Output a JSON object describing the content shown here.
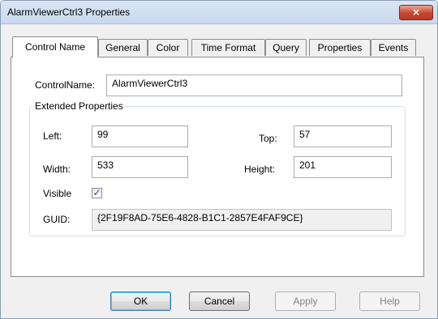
{
  "window": {
    "title": "AlarmViewerCtrl3 Properties",
    "close_label": "×"
  },
  "tabs": [
    {
      "label": "Control Name",
      "active": true
    },
    {
      "label": "General"
    },
    {
      "label": "Color"
    },
    {
      "label": "Time Format"
    },
    {
      "label": "Query"
    },
    {
      "label": "Properties"
    },
    {
      "label": "Events"
    }
  ],
  "control_name": {
    "label": "ControlName:",
    "value": "AlarmViewerCtrl3"
  },
  "extended": {
    "title": "Extended Properties",
    "left_label": "Left:",
    "left_value": "99",
    "top_label": "Top:",
    "top_value": "57",
    "width_label": "Width:",
    "width_value": "533",
    "height_label": "Height:",
    "height_value": "201",
    "visible_label": "Visible",
    "visible_checked": true,
    "check_glyph": "✓",
    "guid_label": "GUID:",
    "guid_value": "{2F19F8AD-75E6-4828-B1C1-2857E4FAF9CE}"
  },
  "buttons": {
    "ok": "OK",
    "cancel": "Cancel",
    "apply": "Apply",
    "help": "Help"
  }
}
